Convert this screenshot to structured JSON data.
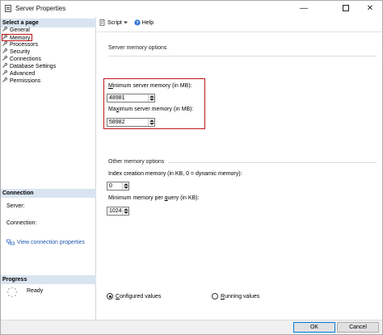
{
  "window": {
    "title": "Server Properties",
    "minimize_glyph": "—",
    "close_glyph": "✕"
  },
  "sidebar": {
    "select_header": "Select a page",
    "items": [
      {
        "label": "General"
      },
      {
        "label": "Memory"
      },
      {
        "label": "Processors"
      },
      {
        "label": "Security"
      },
      {
        "label": "Connections"
      },
      {
        "label": "Database Settings"
      },
      {
        "label": "Advanced"
      },
      {
        "label": "Permissions"
      }
    ],
    "connection_header": "Connection",
    "server_label": "Server:",
    "connection_label": "Connection:",
    "view_connection_link": "View connection properties",
    "progress_header": "Progress",
    "progress_status": "Ready"
  },
  "toolbar": {
    "script_label": "Script",
    "help_label": "Help"
  },
  "memory": {
    "server_memory_group": "Server memory options",
    "min_label_mn": "M",
    "min_label_rest": "inimum server memory (in MB):",
    "min_value": "48981",
    "max_label_pre": "Ma",
    "max_label_mn": "x",
    "max_label_rest": "imum server memory (in MB):",
    "max_value": "58982",
    "other_group": "Other memory options",
    "index_label": "Index creation memory (in KB, 0 = dynamic memory):",
    "index_value": "0",
    "query_label_pre": "Minimum memory per ",
    "query_label_mn": "q",
    "query_label_rest": "uery (in KB):",
    "query_value": "1024",
    "configured_pre": "",
    "configured_mn": "C",
    "configured_rest": "onfigured values",
    "running_mn": "R",
    "running_rest": "unning values",
    "selected_radio": "configured"
  },
  "footer": {
    "ok_label": "OK",
    "cancel_label": "Cancel"
  },
  "colors": {
    "highlight": "#c0141c",
    "section_header_bg": "#d9e4f0",
    "link": "#1f57b0"
  }
}
